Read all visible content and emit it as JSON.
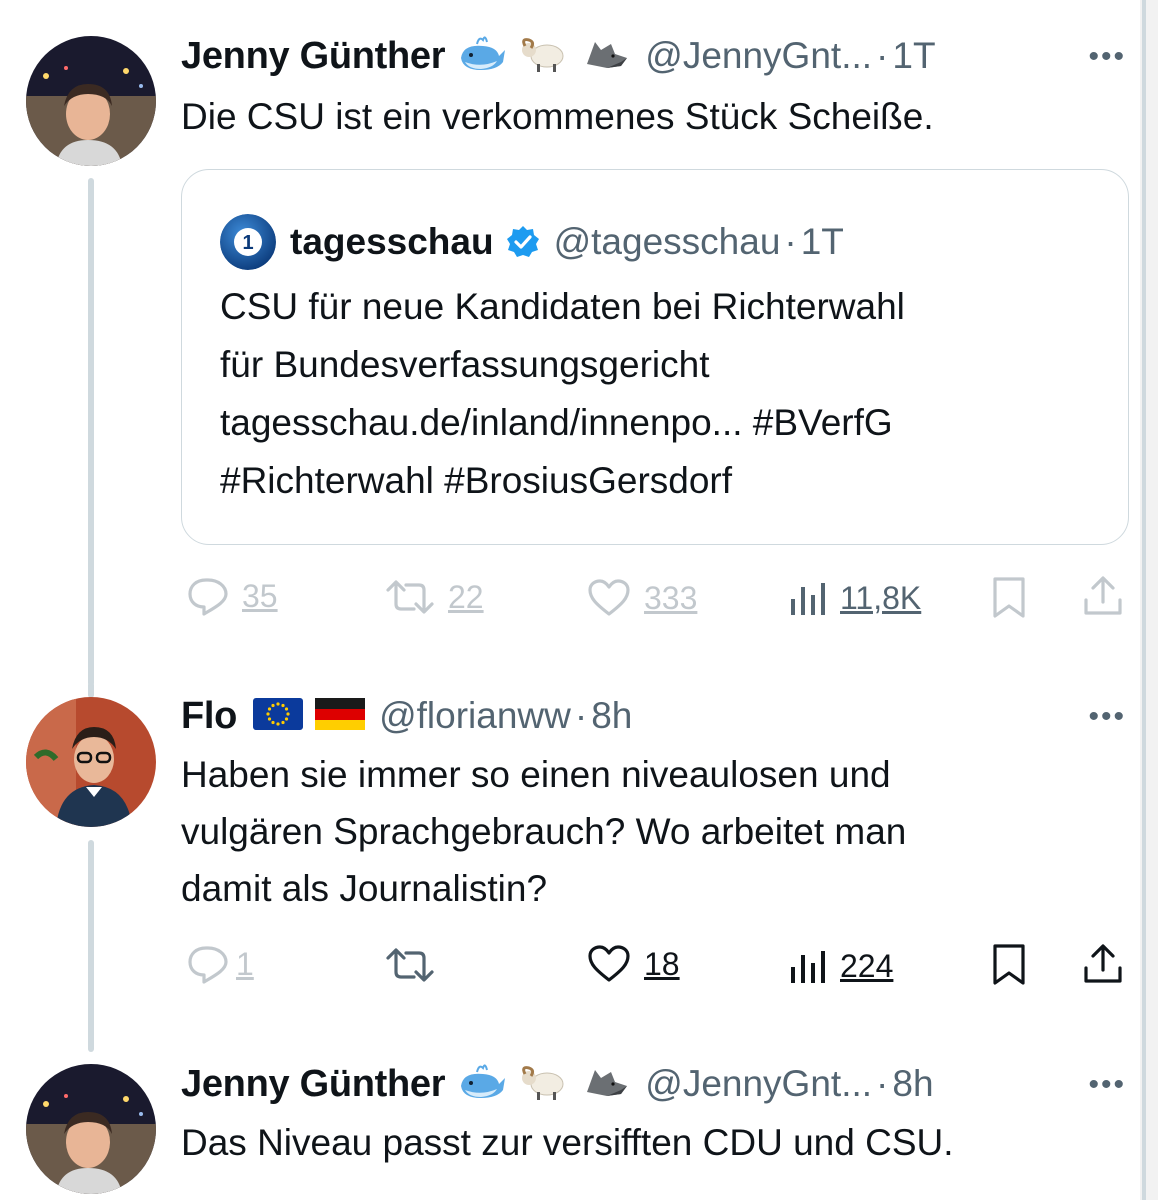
{
  "tweets": [
    {
      "author": {
        "name": "Jenny Günther",
        "handle": "@JennyGnt...",
        "emoji": [
          "🐳",
          "🐏",
          "🐺"
        ]
      },
      "time": "1T",
      "text": "Die CSU ist ein verkommenes Stück Scheiße.",
      "quote": {
        "name": "tagesschau",
        "handle": "@tagesschau",
        "time": "1T",
        "logo_text": "1",
        "text": "CSU für neue Kandidaten bei Richterwahl\nfür Bundesverfassungsgericht\ntagesschau.de/inland/innenpo... #BVerfG\n#Richterwahl #BrosiusGersdorf"
      },
      "stats": {
        "replies": "35",
        "retweets": "22",
        "likes": "333",
        "views": "11,8K"
      }
    },
    {
      "author": {
        "name": "Flo",
        "handle": "@florianww",
        "emoji": [
          "EU-flag",
          "DE-flag"
        ]
      },
      "time": "8h",
      "text": "Haben sie immer so einen niveaulosen und\nvulgären Sprachgebrauch? Wo arbeitet man\ndamit als Journalistin?",
      "stats": {
        "replies": "1",
        "retweets": "",
        "likes": "18",
        "views": "224"
      }
    },
    {
      "author": {
        "name": "Jenny Günther",
        "handle": "@JennyGnt...",
        "emoji": [
          "🐳",
          "🐏",
          "🐺"
        ]
      },
      "time": "8h",
      "text": "Das Niveau passt zur versifften CDU und CSU."
    }
  ],
  "ui": {
    "separator": "·",
    "more": "•••"
  },
  "colors": {
    "text": "#0f1419",
    "muted": "#536471",
    "border": "#cfd9de",
    "verified": "#1d9bf0"
  }
}
